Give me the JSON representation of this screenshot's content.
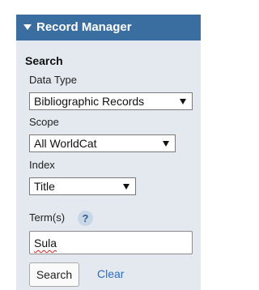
{
  "panel": {
    "title": "Record Manager",
    "header_color": "#3a6ea0",
    "background_color": "#e4e9f0"
  },
  "search": {
    "section_title": "Search",
    "data_type": {
      "label": "Data Type",
      "selected": "Bibliographic Records"
    },
    "scope": {
      "label": "Scope",
      "selected": "All WorldCat"
    },
    "index": {
      "label": "Index",
      "selected": "Title"
    },
    "terms": {
      "label": "Term(s)",
      "help_symbol": "?",
      "value": "Sula"
    },
    "search_button_label": "Search",
    "clear_link_label": "Clear",
    "link_color": "#2a6ebb"
  }
}
